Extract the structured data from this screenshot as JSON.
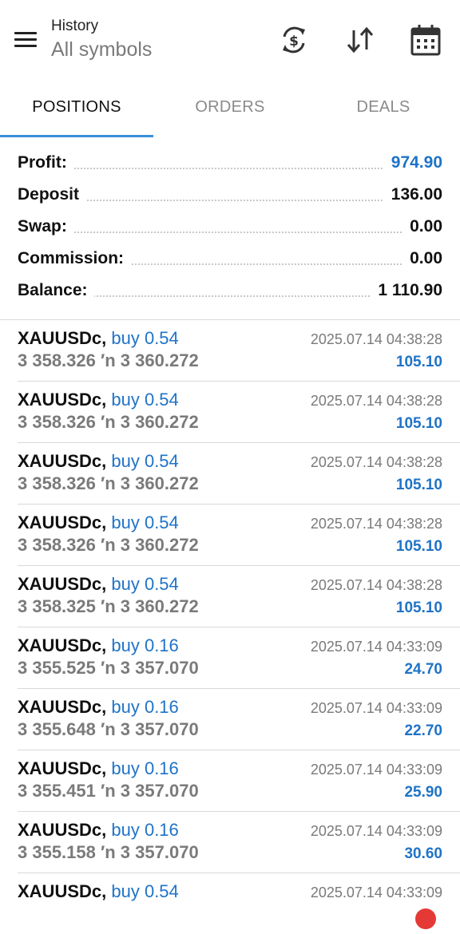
{
  "header": {
    "title": "History",
    "subtitle": "All symbols",
    "icons": [
      "currency-exchange-icon",
      "sort-icon",
      "calendar-icon"
    ]
  },
  "tabs": [
    {
      "label": "POSITIONS",
      "active": true
    },
    {
      "label": "ORDERS",
      "active": false
    },
    {
      "label": "DEALS",
      "active": false
    }
  ],
  "summary": [
    {
      "label": "Profit:",
      "value": "974.90",
      "highlight": true
    },
    {
      "label": "Deposit",
      "value": "136.00",
      "highlight": false
    },
    {
      "label": "Swap:",
      "value": "0.00",
      "highlight": false
    },
    {
      "label": "Commission:",
      "value": "0.00",
      "highlight": false
    },
    {
      "label": "Balance:",
      "value": "1 110.90",
      "highlight": false
    }
  ],
  "deals": [
    {
      "symbol": "XAUUSDc,",
      "side": "buy 0.54",
      "prices": "3 358.326 ′n  3 360.272",
      "time": "2025.07.14 04:38:28",
      "profit": "105.10"
    },
    {
      "symbol": "XAUUSDc,",
      "side": "buy 0.54",
      "prices": "3 358.326 ′n  3 360.272",
      "time": "2025.07.14 04:38:28",
      "profit": "105.10"
    },
    {
      "symbol": "XAUUSDc,",
      "side": "buy 0.54",
      "prices": "3 358.326 ′n  3 360.272",
      "time": "2025.07.14 04:38:28",
      "profit": "105.10"
    },
    {
      "symbol": "XAUUSDc,",
      "side": "buy 0.54",
      "prices": "3 358.326 ′n  3 360.272",
      "time": "2025.07.14 04:38:28",
      "profit": "105.10"
    },
    {
      "symbol": "XAUUSDc,",
      "side": "buy 0.54",
      "prices": "3 358.325 ′n  3 360.272",
      "time": "2025.07.14 04:38:28",
      "profit": "105.10"
    },
    {
      "symbol": "XAUUSDc,",
      "side": "buy 0.16",
      "prices": "3 355.525 ′n  3 357.070",
      "time": "2025.07.14 04:33:09",
      "profit": "24.70"
    },
    {
      "symbol": "XAUUSDc,",
      "side": "buy 0.16",
      "prices": "3 355.648 ′n  3 357.070",
      "time": "2025.07.14 04:33:09",
      "profit": "22.70"
    },
    {
      "symbol": "XAUUSDc,",
      "side": "buy 0.16",
      "prices": "3 355.451 ′n  3 357.070",
      "time": "2025.07.14 04:33:09",
      "profit": "25.90"
    },
    {
      "symbol": "XAUUSDc,",
      "side": "buy 0.16",
      "prices": "3 355.158 ′n  3 357.070",
      "time": "2025.07.14 04:33:09",
      "profit": "30.60"
    },
    {
      "symbol": "XAUUSDc,",
      "side": "buy 0.54",
      "prices": "",
      "time": "2025.07.14 04:33:09",
      "profit": ""
    }
  ],
  "colors": {
    "accent": "#1f73c7",
    "tab_indicator": "#3b8fdc",
    "muted": "#7a7a7a"
  }
}
